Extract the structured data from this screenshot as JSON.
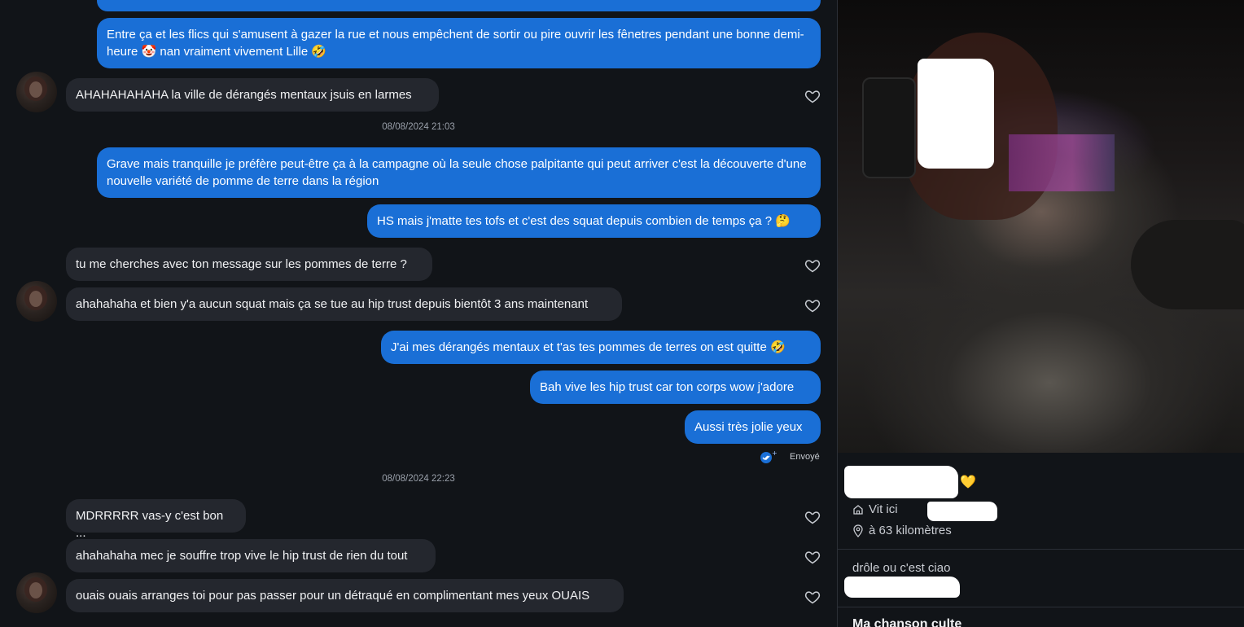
{
  "messages": [
    {
      "dir": "out",
      "text": "Entre ça et les flics qui s'amusent à gazer la rue et nous empêchent de sortir ou pire ouvrir les fênetres pendant une bonne demi-heure",
      "emoji1": "🤡",
      "text2": "nan vraiment vivement Lille",
      "emoji2": "🤣"
    },
    {
      "dir": "in",
      "text": "AHAHAHAHAHA la ville de dérangés mentaux jsuis en larmes"
    },
    {
      "dir": "out",
      "text": "Grave mais tranquille je préfère peut-être ça à la campagne où la seule chose palpitante qui peut arriver c'est la découverte d'une nouvelle variété de pomme de terre dans la région"
    },
    {
      "dir": "out",
      "text": "HS mais j'matte tes tofs et c'est des squat depuis combien de temps ça ?",
      "emoji1": "🤔"
    },
    {
      "dir": "in",
      "text": "tu me cherches avec ton message sur les pommes de terre ?"
    },
    {
      "dir": "in",
      "text": "ahahahaha et bien y'a aucun squat mais ça se tue au hip trust depuis bientôt 3 ans maintenant"
    },
    {
      "dir": "out",
      "text": "J'ai mes dérangés mentaux et t'as tes pommes de terres on est quitte",
      "emoji1": "🤣"
    },
    {
      "dir": "out",
      "text": "Bah vive les hip trust car ton corps wow j'adore"
    },
    {
      "dir": "out",
      "text": "Aussi très jolie yeux"
    },
    {
      "dir": "in",
      "text": "MDRRRRR vas-y c'est bon ..."
    },
    {
      "dir": "in",
      "text": "ahahahaha mec je souffre trop vive le hip trust de rien du tout"
    },
    {
      "dir": "in",
      "text": "ouais ouais arranges toi pour pas passer pour un détraqué en complimentant mes yeux OUAIS"
    }
  ],
  "timestamps": [
    "08/08/2024 21:03",
    "08/08/2024 22:23"
  ],
  "status": {
    "sent_label": "Envoyé"
  },
  "profile": {
    "name_emoji": "💛",
    "lives_label": "Vit ici",
    "distance": "à 63 kilomètres",
    "bio_line": "drôle ou c'est ciao",
    "section_title": "Ma chanson culte"
  },
  "colors": {
    "outgoing": "#1a6fd6",
    "incoming": "#24272e",
    "background": "#111418"
  },
  "icons": [
    "heart-icon",
    "home-icon",
    "location-pin-icon",
    "double-check-icon"
  ]
}
